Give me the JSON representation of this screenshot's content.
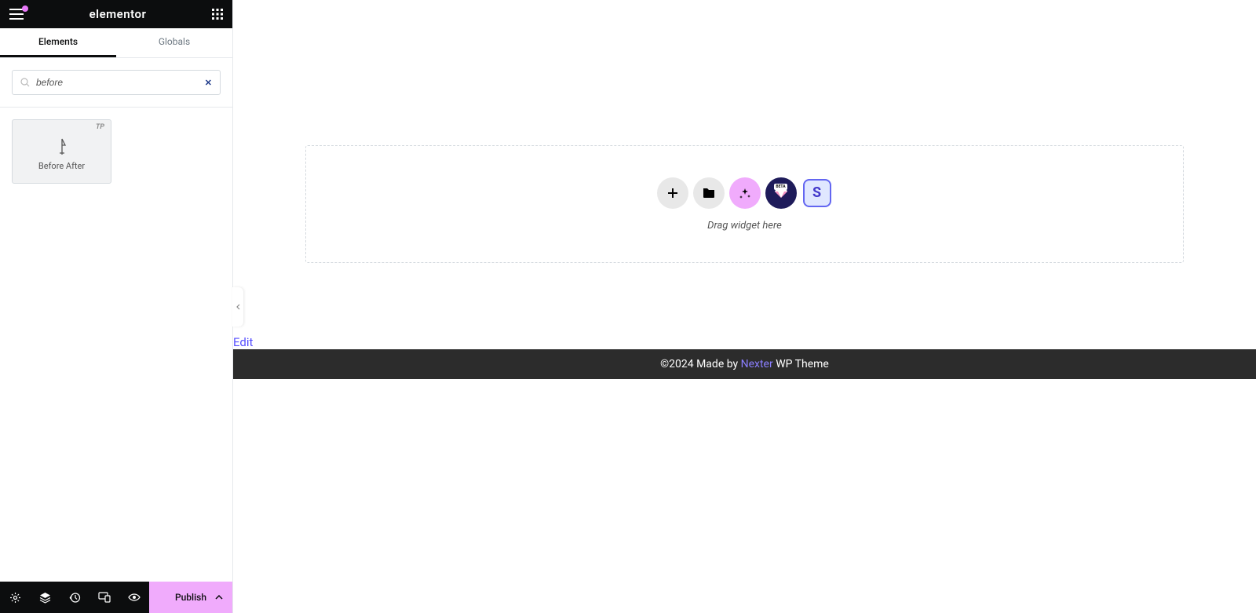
{
  "header": {
    "logo": "elementor"
  },
  "tabs": {
    "elements": "Elements",
    "globals": "Globals"
  },
  "search": {
    "value": "before"
  },
  "widgets": [
    {
      "label": "Before After",
      "badge": "TP"
    }
  ],
  "footer": {
    "publish": "Publish"
  },
  "canvas": {
    "drag_text": "Drag widget here",
    "edit": "Edit"
  },
  "pagefooter": {
    "prefix": "©2024 Made by ",
    "link": "Nexter",
    "suffix": " WP Theme"
  },
  "dzbuttons": {
    "beta": "BETA",
    "s": "S"
  }
}
